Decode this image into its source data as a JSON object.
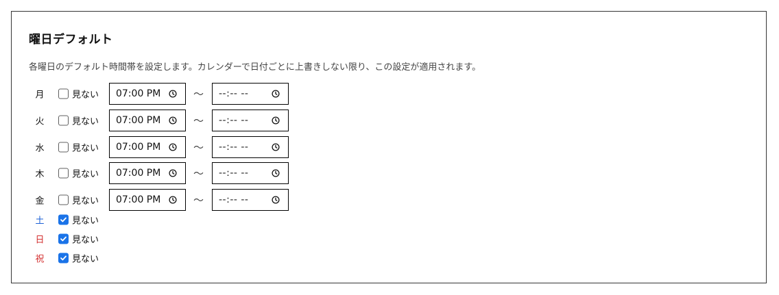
{
  "section": {
    "title": "曜日デフォルト",
    "description": "各曜日のデフォルト時間帯を設定します。カレンダーで日付ごとに上書きしない限り、この設定が適用されます。",
    "hide_label": "見ない",
    "range_separator": "〜"
  },
  "days": [
    {
      "label": "月",
      "color": "#111111",
      "hidden": false,
      "start": "07:00 PM",
      "end": "--:-- --"
    },
    {
      "label": "火",
      "color": "#111111",
      "hidden": false,
      "start": "07:00 PM",
      "end": "--:-- --"
    },
    {
      "label": "水",
      "color": "#111111",
      "hidden": false,
      "start": "07:00 PM",
      "end": "--:-- --"
    },
    {
      "label": "木",
      "color": "#111111",
      "hidden": false,
      "start": "07:00 PM",
      "end": "--:-- --"
    },
    {
      "label": "金",
      "color": "#111111",
      "hidden": false,
      "start": "07:00 PM",
      "end": "--:-- --"
    },
    {
      "label": "土",
      "color": "#1a5fd6",
      "hidden": true
    },
    {
      "label": "日",
      "color": "#d32f2f",
      "hidden": true
    },
    {
      "label": "祝",
      "color": "#d32f2f",
      "hidden": true
    }
  ],
  "icons": {
    "checkbox_check": "check-icon",
    "time_picker": "clock-icon"
  },
  "colors": {
    "checkbox_checked": "#1a73e8",
    "saturday": "#1a5fd6",
    "sunday_holiday": "#d32f2f"
  }
}
